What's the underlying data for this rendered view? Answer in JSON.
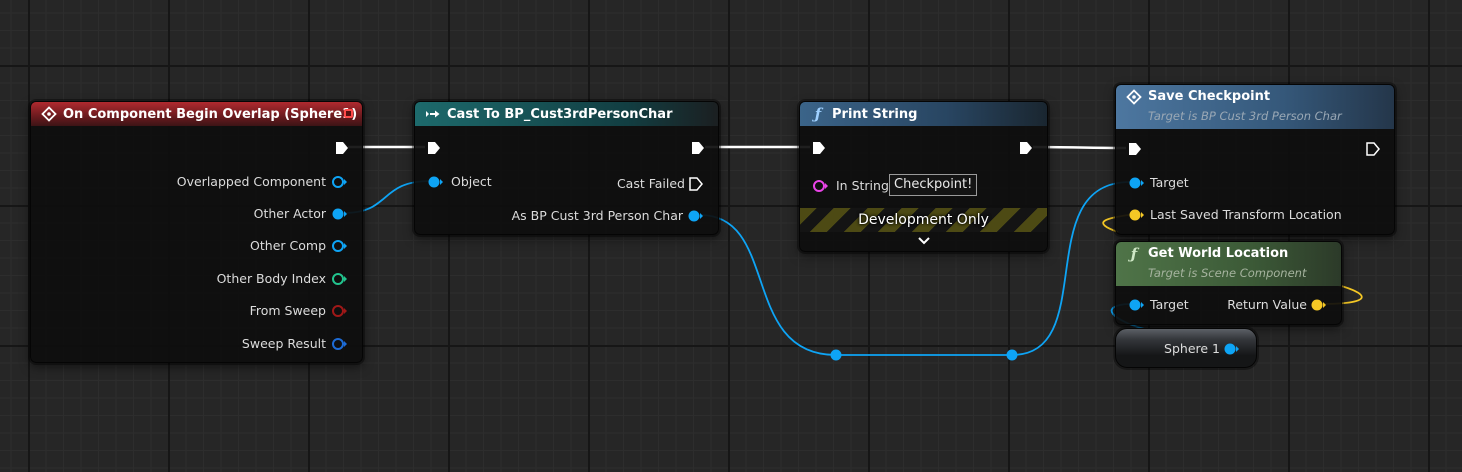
{
  "nodes": {
    "overlap": {
      "title": "On Component Begin Overlap (Sphere1)",
      "pins": [
        "Overlapped Component",
        "Other Actor",
        "Other Comp",
        "Other Body Index",
        "From Sweep",
        "Sweep Result"
      ]
    },
    "cast": {
      "title": "Cast To BP_Cust3rdPersonChar",
      "object_label": "Object",
      "cast_failed_label": "Cast Failed",
      "as_label": "As BP Cust 3rd Person Char"
    },
    "print": {
      "title": "Print String",
      "in_string_label": "In String",
      "in_string_value": "Checkpoint!",
      "dev_only_label": "Development Only",
      "expand_icon": "chevron-down-icon"
    },
    "save": {
      "title": "Save Checkpoint",
      "subtitle": "Target is BP Cust 3rd Person Char",
      "target_label": "Target",
      "last_saved_label": "Last Saved Transform Location"
    },
    "getloc": {
      "title": "Get World Location",
      "subtitle": "Target is Scene Component",
      "target_label": "Target",
      "return_label": "Return Value"
    },
    "sphere": {
      "label": "Sphere 1"
    }
  },
  "colors": {
    "exec": "#ffffff",
    "object": "#0ea4f5",
    "struct": "#1d6bd5",
    "int": "#22c48e",
    "bool": "#a01818",
    "string": "#ea44e8",
    "vector": "#f5c825"
  }
}
